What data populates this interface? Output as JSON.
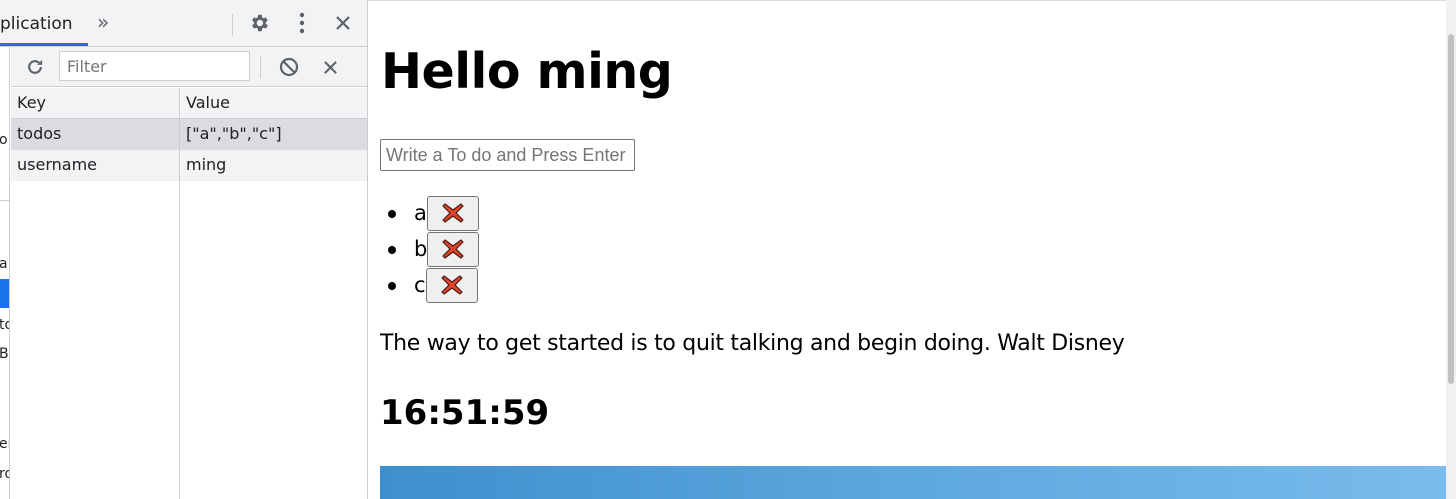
{
  "devtools": {
    "active_tab": "plication",
    "more_tabs_glyph": "»",
    "filter": {
      "placeholder": "Filter",
      "value": ""
    },
    "table": {
      "headers": [
        "Key",
        "Value"
      ],
      "rows": [
        {
          "key": "todos",
          "value": "[\"a\",\"b\",\"c\"]"
        },
        {
          "key": "username",
          "value": "ming"
        }
      ]
    },
    "sidebar_fragments": [
      "o",
      "a",
      "to",
      "B",
      "er",
      "ro"
    ]
  },
  "page": {
    "greeting": "Hello ming",
    "todo_input": {
      "placeholder": "Write a To do and Press Enter",
      "value": ""
    },
    "todos": [
      {
        "text": "a",
        "delete_glyph": "❌"
      },
      {
        "text": "b",
        "delete_glyph": "❌"
      },
      {
        "text": "c",
        "delete_glyph": "❌"
      }
    ],
    "quote": "The way to get started is to quit talking and begin doing. Walt Disney",
    "clock": "16:51:59"
  },
  "colors": {
    "accent_blue": "#1a73e8",
    "delete_red": "#e0452c",
    "selected_row": "#dadce0"
  }
}
